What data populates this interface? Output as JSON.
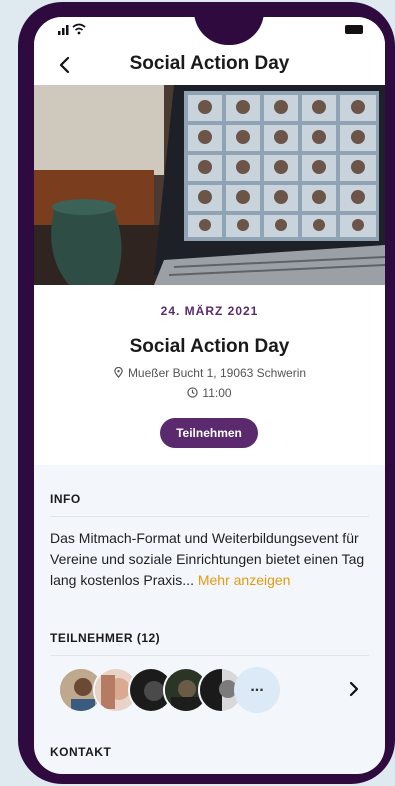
{
  "status": {
    "signal": "ıll"
  },
  "nav": {
    "title": "Social Action Day",
    "back_icon": "chevron-left-icon"
  },
  "event": {
    "date": "24. MÄRZ 2021",
    "title": "Social Action Day",
    "address": "Mueßer Bucht 1, 19063 Schwerin",
    "time": "11:00",
    "join_label": "Teilnehmen"
  },
  "info": {
    "heading": "INFO",
    "text": "Das Mitmach-Format und Weiterbildungsevent für Vereine und soziale Einrichtungen bietet einen Tag lang kostenlos Praxis...",
    "more_label": "Mehr anzeigen"
  },
  "participants": {
    "heading": "TEILNEHMER (12)",
    "more_label": "...",
    "avatars": [
      "avatar-1",
      "avatar-2",
      "avatar-3",
      "avatar-4",
      "avatar-5"
    ]
  },
  "contact": {
    "heading": "KONTAKT"
  },
  "colors": {
    "accent": "#5b2a6e",
    "link": "#e39a12",
    "frame": "#2e0a3e"
  }
}
